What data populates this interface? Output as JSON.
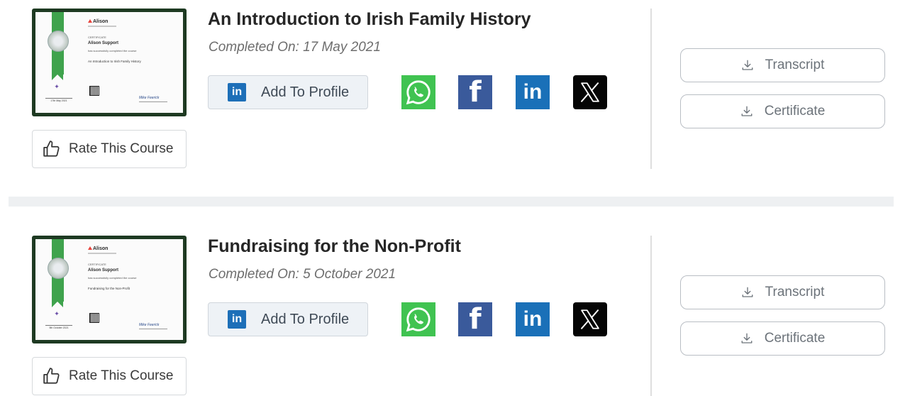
{
  "courses": [
    {
      "title": "An Introduction to Irish Family History",
      "completed": "Completed On: 17 May 2021",
      "certificate": {
        "brand": "Alison",
        "heading": "CERTIFICATE",
        "recipient": "Alison Support",
        "statement": "has successfully completed the course",
        "course": "An Introduction to Irish Family History",
        "date": "17th May 2021",
        "signature": "Mike Feerick"
      },
      "rate_label": "Rate This Course",
      "add_profile_label": "Add To Profile",
      "transcript_label": "Transcript",
      "certificate_label": "Certificate"
    },
    {
      "title": "Fundraising for the Non-Profit",
      "completed": "Completed On: 5 October 2021",
      "certificate": {
        "brand": "Alison",
        "heading": "CERTIFICATE",
        "recipient": "Alison Support",
        "statement": "has successfully completed the course",
        "course": "Fundraising for the Non-Profit",
        "date": "5th October 2021",
        "signature": "Mike Feerick"
      },
      "rate_label": "Rate This Course",
      "add_profile_label": "Add To Profile",
      "transcript_label": "Transcript",
      "certificate_label": "Certificate"
    }
  ],
  "share": {
    "icons": [
      "whatsapp-icon",
      "facebook-icon",
      "linkedin-icon",
      "x-icon"
    ],
    "linkedin_text": "in",
    "facebook_text": "f",
    "colors": {
      "whatsapp": "#40c351",
      "facebook": "#3a5a9b",
      "linkedin": "#1a70b8",
      "x": "#050505"
    }
  },
  "colors": {
    "cert_frame": "#1e3a22",
    "ribbon": "#3fa34d",
    "add_profile_bg": "#eef2f6"
  }
}
